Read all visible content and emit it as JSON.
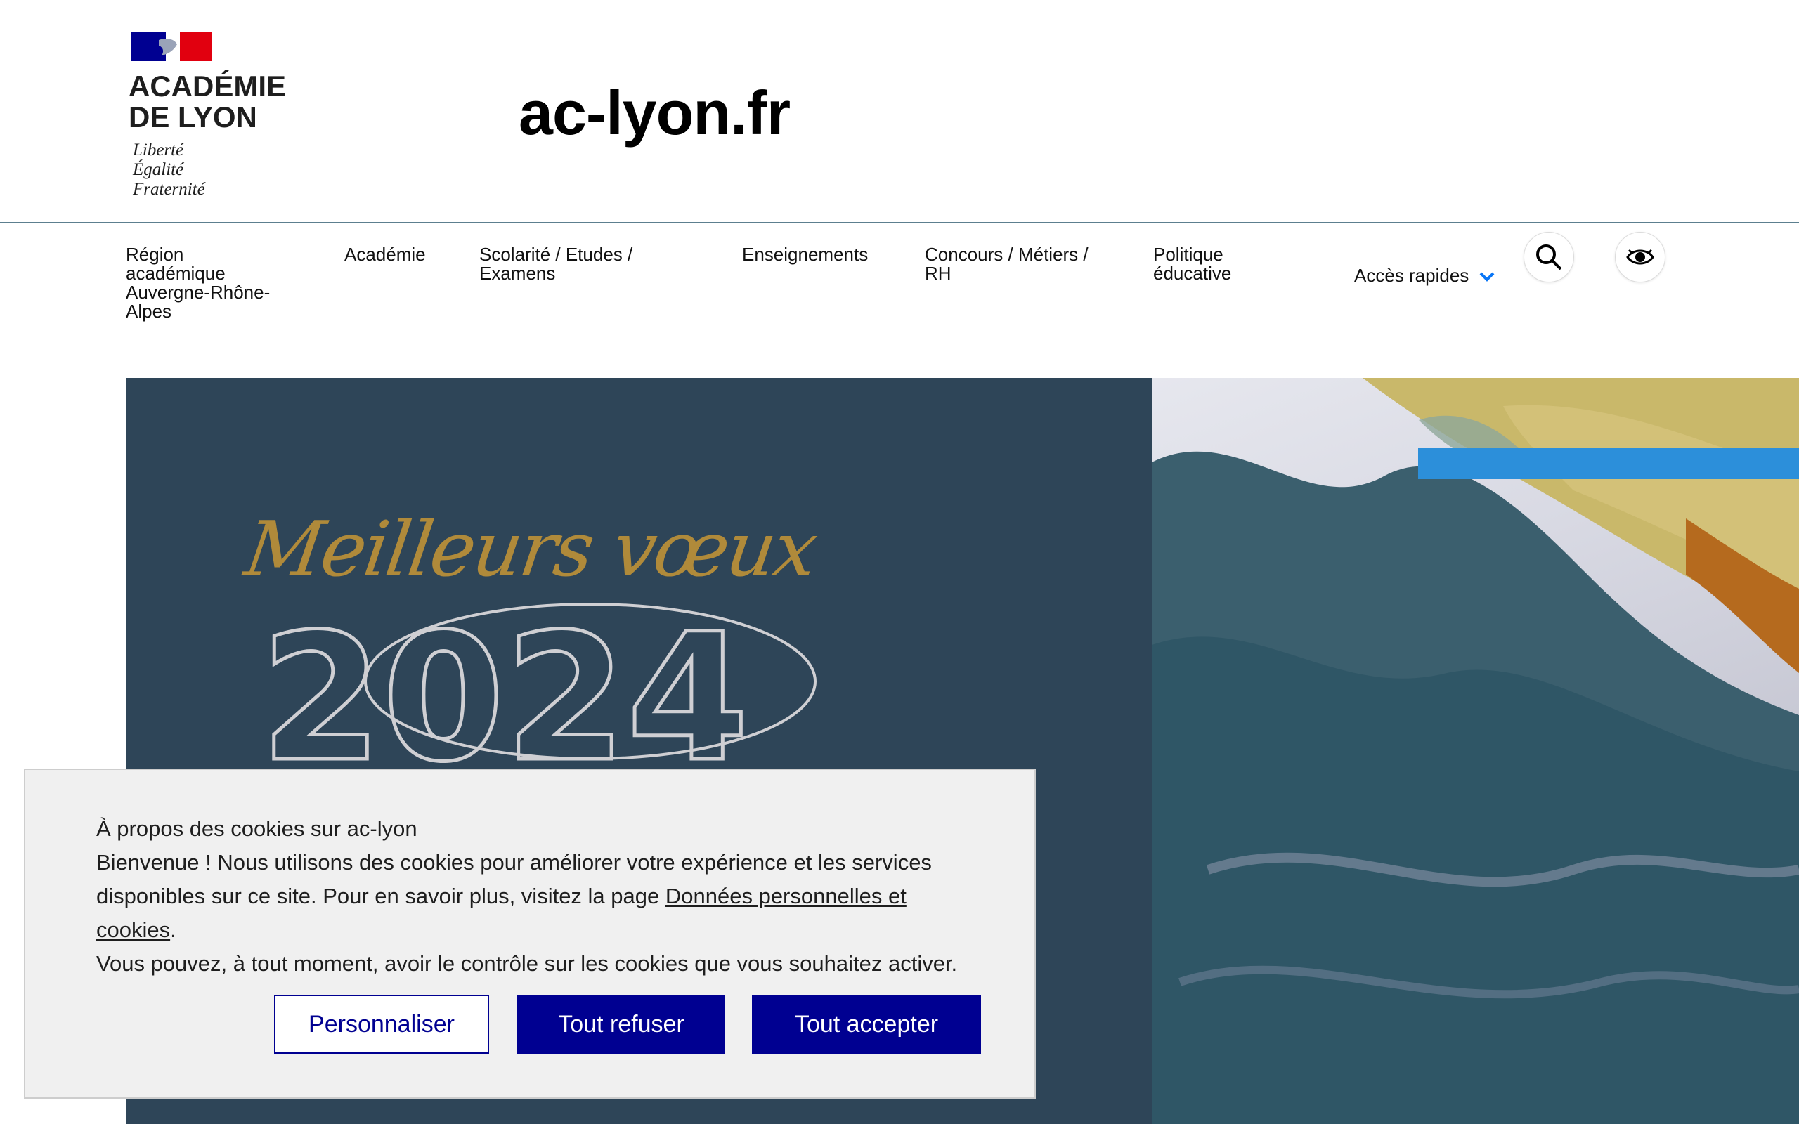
{
  "header": {
    "logo_lines": [
      "ACADÉMIE",
      "DE LYON"
    ],
    "motto": [
      "Liberté",
      "Égalité",
      "Fraternité"
    ],
    "site_title": "ac-lyon.fr"
  },
  "nav": {
    "items": [
      {
        "label": "Région académique Auvergne-Rhône-Alpes"
      },
      {
        "label": "Académie"
      },
      {
        "label": "Scolarité / Etudes / Examens"
      },
      {
        "label": "Enseignements"
      },
      {
        "label": "Concours / Métiers / RH"
      },
      {
        "label": "Politique éducative"
      }
    ],
    "quick_access_label": "Accès rapides",
    "icons": [
      "search-icon",
      "eye-icon",
      "chevron-down-icon"
    ],
    "accent_color": "#0a76f6"
  },
  "hero": {
    "greeting": "Meilleurs vœux",
    "year": "2024"
  },
  "cookie_banner": {
    "title": "À propos des cookies sur ac-lyon",
    "text_before_link": "Bienvenue ! Nous utilisons des cookies pour améliorer votre expérience et les services disponibles sur ce site. Pour en savoir plus, visitez la page ",
    "link_text": "Données personnelles et cookies",
    "text_after_link": ".",
    "text_line_last": "Vous pouvez, à tout moment, avoir le contrôle sur les cookies que vous souhaitez activer.",
    "buttons": {
      "customize": "Personnaliser",
      "refuse": "Tout refuser",
      "accept": "Tout accepter"
    },
    "primary_color": "#000091"
  }
}
